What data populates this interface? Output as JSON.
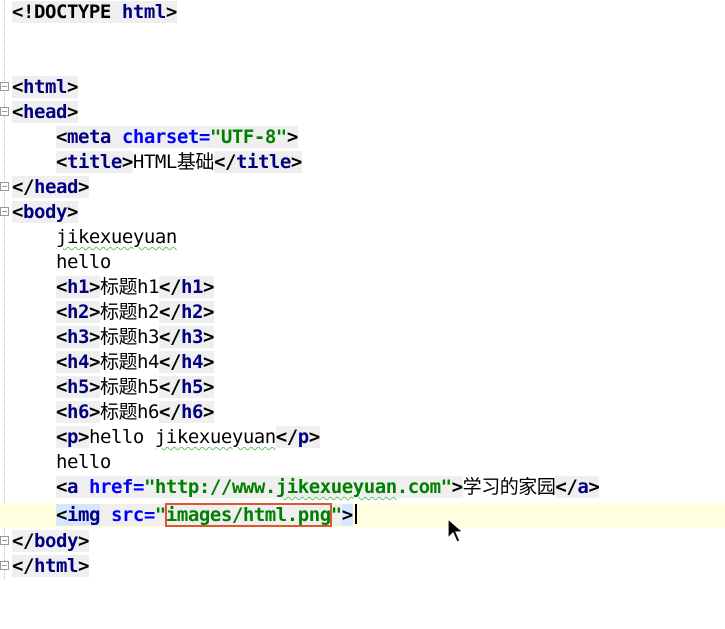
{
  "editor": {
    "lines": {
      "doctype_open": "<!DOCTYPE",
      "doctype_kw": "html",
      "doctype_close": ">",
      "html_open": "html",
      "head_open": "head",
      "meta_tag": "meta",
      "meta_attr": "charset",
      "meta_eq": "=",
      "meta_val": "\"UTF-8\"",
      "title_tag": "title",
      "title_text": "HTML基础",
      "head_close": "head",
      "body_open": "body",
      "text1": "jikexueyuan",
      "text2": "hello",
      "h1_text": "标题h1",
      "h2_text": "标题h2",
      "h3_text": "标题h3",
      "h4_text": "标题h4",
      "h5_text": "标题h5",
      "h6_text": "标题h6",
      "p_tag": "p",
      "p_text_a": "hello ",
      "p_text_b": "jikexueyuan",
      "text3": "hello",
      "a_tag": "a",
      "a_attr": "href",
      "a_val_a": "\"http://www.",
      "a_val_b": "jikexueyuan",
      "a_val_c": ".com\"",
      "a_text": "学习的家园",
      "img_tag": "img",
      "img_attr": "src",
      "img_q1": "\"",
      "img_val": "images/html.png",
      "img_q2": "\"",
      "body_close": "body",
      "html_close": "html"
    },
    "tags": {
      "h1": "h1",
      "h2": "h2",
      "h3": "h3",
      "h4": "h4",
      "h5": "h5",
      "h6": "h6"
    }
  }
}
